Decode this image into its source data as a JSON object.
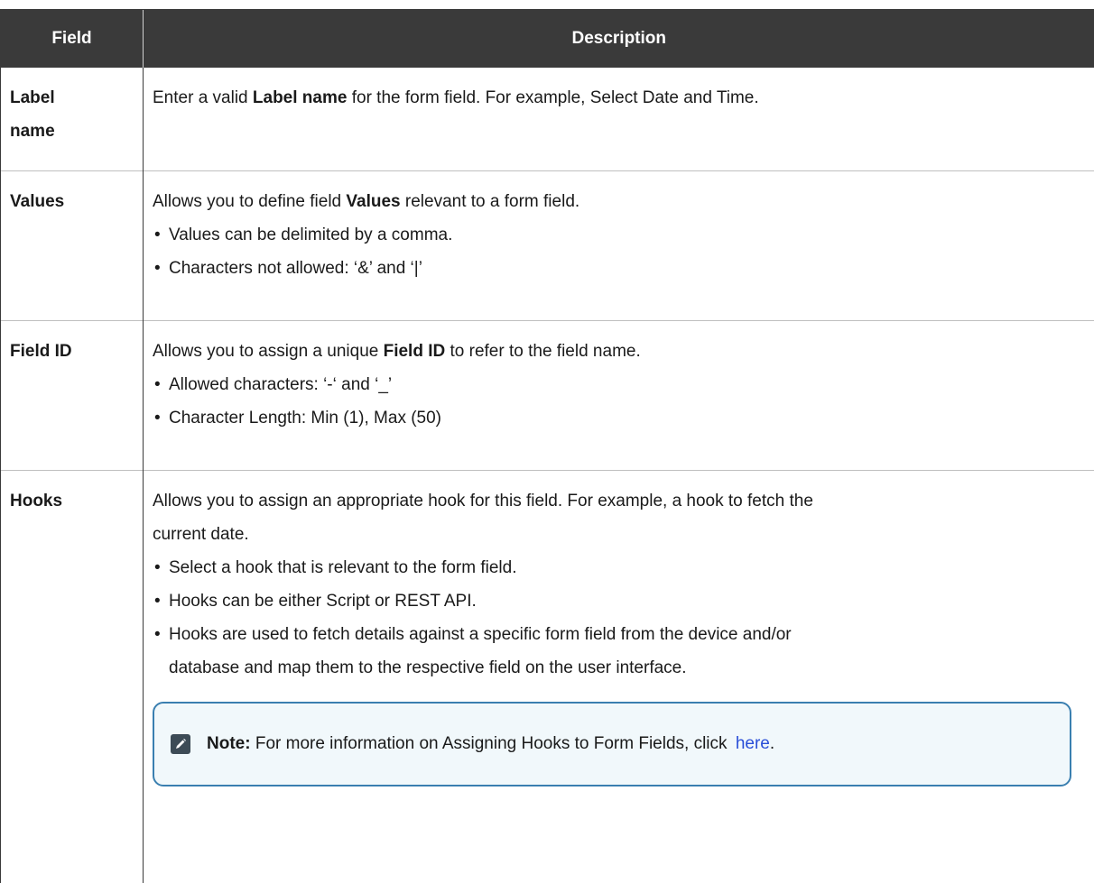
{
  "table": {
    "headers": {
      "field": "Field",
      "description": "Description"
    },
    "rows": [
      {
        "field": "Label name",
        "desc_pre": "Enter a valid ",
        "desc_bold": "Label name",
        "desc_post": " for the form field. For example, Select Date and Time."
      },
      {
        "field": "Values",
        "desc_pre": "Allows you to define field ",
        "desc_bold": "Values",
        "desc_post": " relevant to a form field.",
        "bullets": [
          "Values can be delimited by a comma.",
          "Characters not allowed: ‘&’ and ‘|’"
        ]
      },
      {
        "field": "Field ID",
        "desc_pre": "Allows you to assign a unique ",
        "desc_bold": "Field ID",
        "desc_post": " to refer to the field name.",
        "bullets": [
          "Allowed characters: ‘-‘ and ‘_’",
          "Character Length: Min (1), Max (50)"
        ]
      },
      {
        "field": "Hooks",
        "desc_line1": "Allows you to assign an appropriate hook for this field. For example, a hook to fetch the",
        "desc_line2": "current date.",
        "bullets": [
          "Select a hook that is relevant to the form field.",
          "Hooks can be either Script or REST API."
        ],
        "bullet3_line1": "Hooks are used to fetch details against a specific form field from the device and/or",
        "bullet3_line2": "database and map them to the respective field on the user interface.",
        "note": {
          "label": "Note:",
          "text": " For more information on Assigning Hooks to Form Fields, click ",
          "link": "here",
          "end": ".",
          "icon": "pencil-note-icon"
        }
      }
    ]
  },
  "colors": {
    "header_bg": "#3a3a3a",
    "note_border": "#3a7fb0",
    "note_bg": "#f1f8fb",
    "link": "#2a4fd8"
  }
}
